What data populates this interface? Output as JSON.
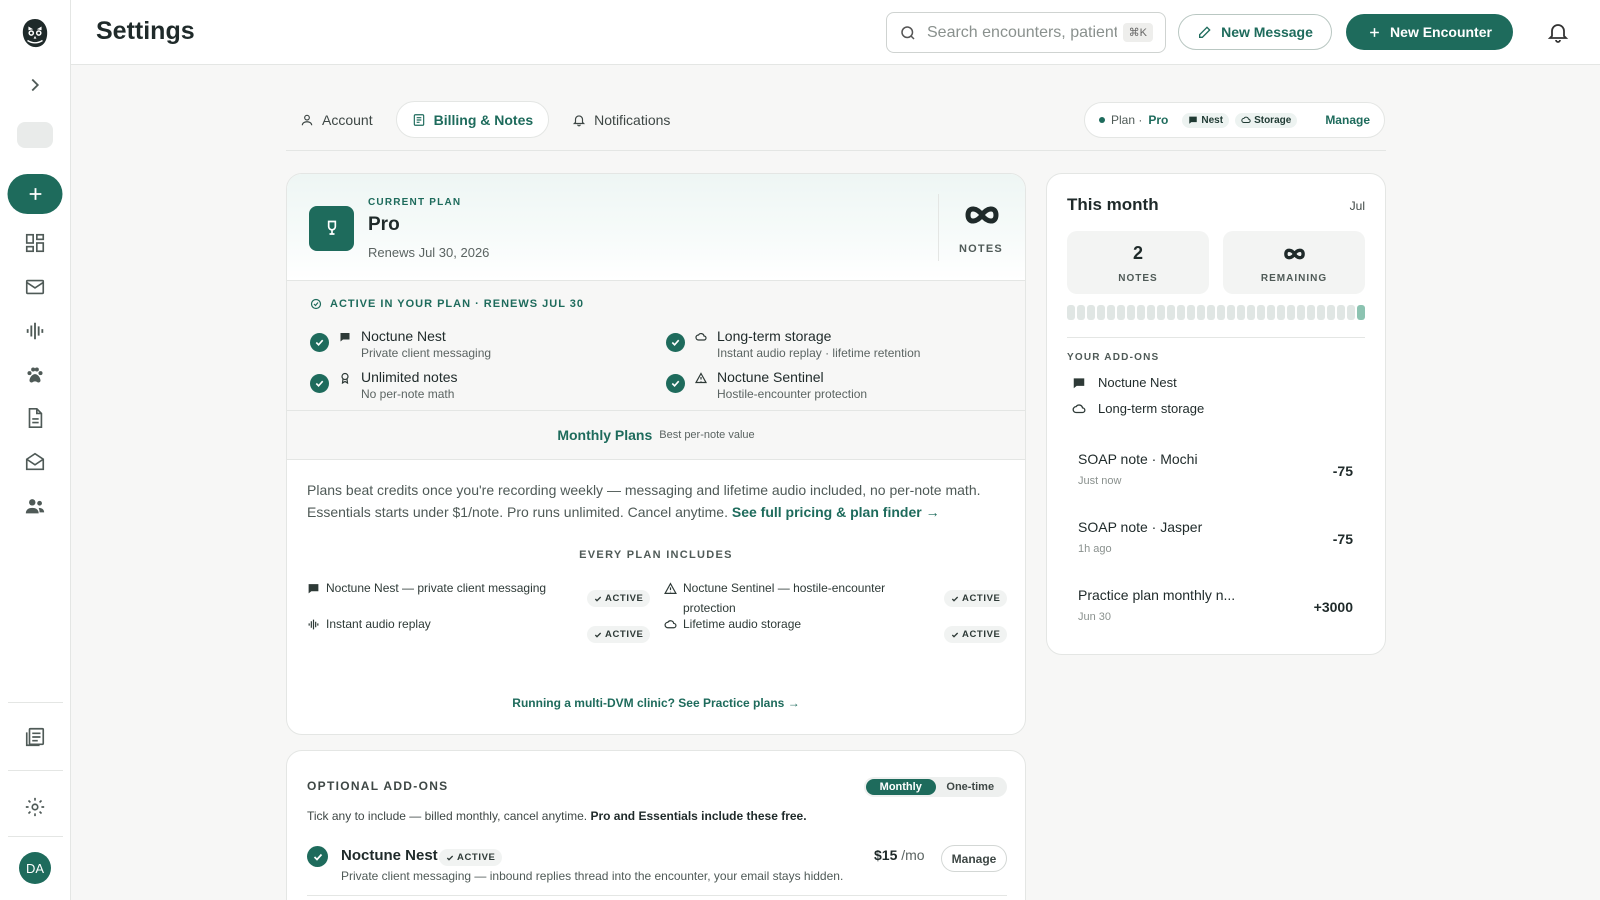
{
  "page_title": "Settings",
  "search": {
    "placeholder": "Search encounters, patients",
    "shortcut": "⌘K"
  },
  "top_actions": {
    "new_message": "New Message",
    "new_encounter": "New Encounter"
  },
  "sidebar": {
    "avatar_initials": "DA"
  },
  "tabs": [
    {
      "label": "Account"
    },
    {
      "label": "Billing & Notes"
    },
    {
      "label": "Notifications"
    }
  ],
  "plan_pill": {
    "label": "Plan ·",
    "plan": "Pro",
    "chip_nest": "Nest",
    "chip_storage": "Storage",
    "manage": "Manage"
  },
  "current_plan": {
    "eyebrow": "CURRENT PLAN",
    "name": "Pro",
    "renews": "Renews Jul 30, 2026",
    "notes_label": "NOTES"
  },
  "active_block": {
    "header": "ACTIVE IN YOUR PLAN · RENEWS JUL 30",
    "features": [
      {
        "title": "Noctune Nest",
        "sub": "Private client messaging"
      },
      {
        "title": "Long-term storage",
        "sub": "Instant audio replay · lifetime retention"
      },
      {
        "title": "Unlimited notes",
        "sub": "No per-note math"
      },
      {
        "title": "Noctune Sentinel",
        "sub": "Hostile-encounter protection"
      }
    ]
  },
  "monthly_plans": {
    "title": "Monthly Plans",
    "sub": "Best per-note value"
  },
  "plans_copy": {
    "text": "Plans beat credits once you're recording weekly — messaging and lifetime audio included, no per-note math. Essentials starts under $1/note. Pro runs unlimited. Cancel anytime.",
    "link": "See full pricing & plan finder →"
  },
  "every_plan": {
    "header": "EVERY PLAN INCLUDES",
    "items": [
      {
        "label": "Noctune Nest — private client messaging",
        "badge": "ACTIVE"
      },
      {
        "label": "Noctune Sentinel — hostile-encounter protection",
        "badge": "ACTIVE"
      },
      {
        "label": "Instant audio replay",
        "badge": "ACTIVE"
      },
      {
        "label": "Lifetime audio storage",
        "badge": "ACTIVE"
      }
    ]
  },
  "practice_link": "Running a multi-DVM clinic? See Practice plans →",
  "addons": {
    "label": "OPTIONAL ADD-ONS",
    "toggle": [
      "Monthly",
      "One-time"
    ],
    "desc": "Tick any to include — billed monthly, cancel anytime.",
    "desc_bold": "Pro and Essentials include these free.",
    "item": {
      "name": "Noctune Nest",
      "badge": "ACTIVE",
      "desc": "Private client messaging — inbound replies thread into the encounter, your email stays hidden.",
      "price": "$15",
      "per": "/mo",
      "manage": "Manage"
    }
  },
  "this_month": {
    "title": "This month",
    "month": "Jul",
    "notes_value": "2",
    "notes_label": "NOTES",
    "remaining_label": "REMAINING",
    "meter": {
      "segments": 30,
      "filled": 1
    },
    "your_addons_label": "YOUR ADD-ONS",
    "your_addons": [
      "Noctune Nest",
      "Long-term storage"
    ],
    "transactions": [
      {
        "name": "SOAP note · Mochi",
        "time": "Just now",
        "amount": "-75"
      },
      {
        "name": "SOAP note · Jasper",
        "time": "1h ago",
        "amount": "-75"
      },
      {
        "name": "Practice plan monthly n...",
        "time": "Jun 30",
        "amount": "+3000"
      }
    ]
  },
  "colors": {
    "accent": "#1e6b5c",
    "background": "#f7f7f6"
  }
}
